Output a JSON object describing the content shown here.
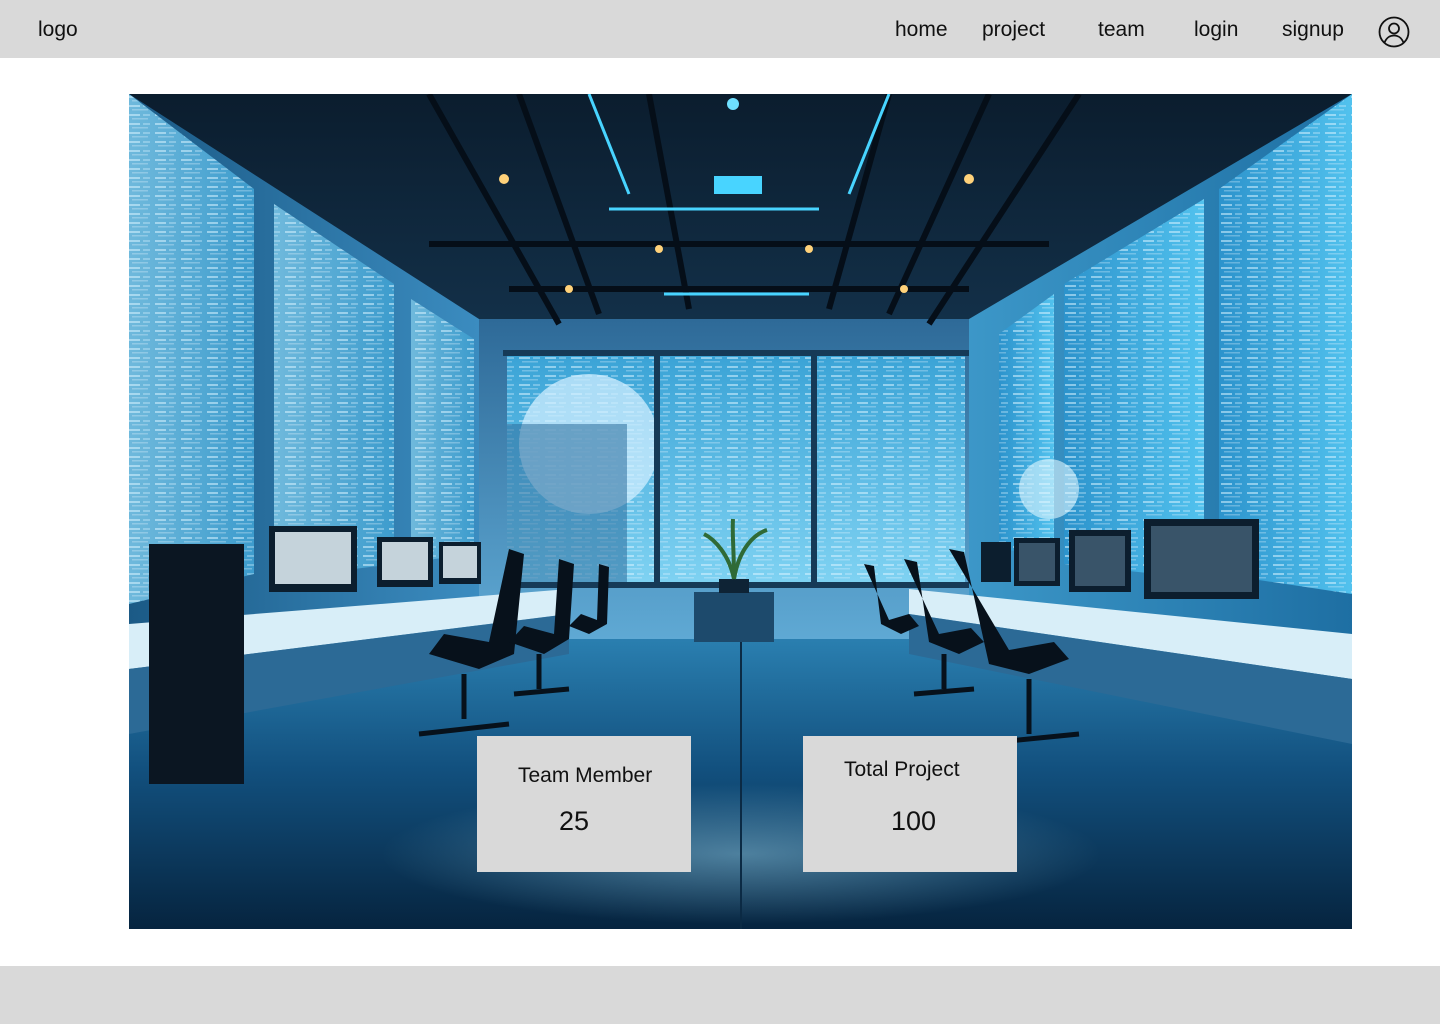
{
  "header": {
    "logo": "logo",
    "nav": [
      {
        "label": "home"
      },
      {
        "label": "project"
      },
      {
        "label": "team"
      },
      {
        "label": "login"
      },
      {
        "label": "signup"
      }
    ],
    "account_icon": "user-circle-icon"
  },
  "hero": {
    "image": "futuristic-office-photo",
    "stats": [
      {
        "label": "Team Member",
        "value": "25"
      },
      {
        "label": "Total Project",
        "value": "100"
      }
    ]
  },
  "colors": {
    "bar_background": "#d9d9d9",
    "page_background": "#ffffff",
    "text": "#111111",
    "scene_accent": "#3fc8f0"
  }
}
